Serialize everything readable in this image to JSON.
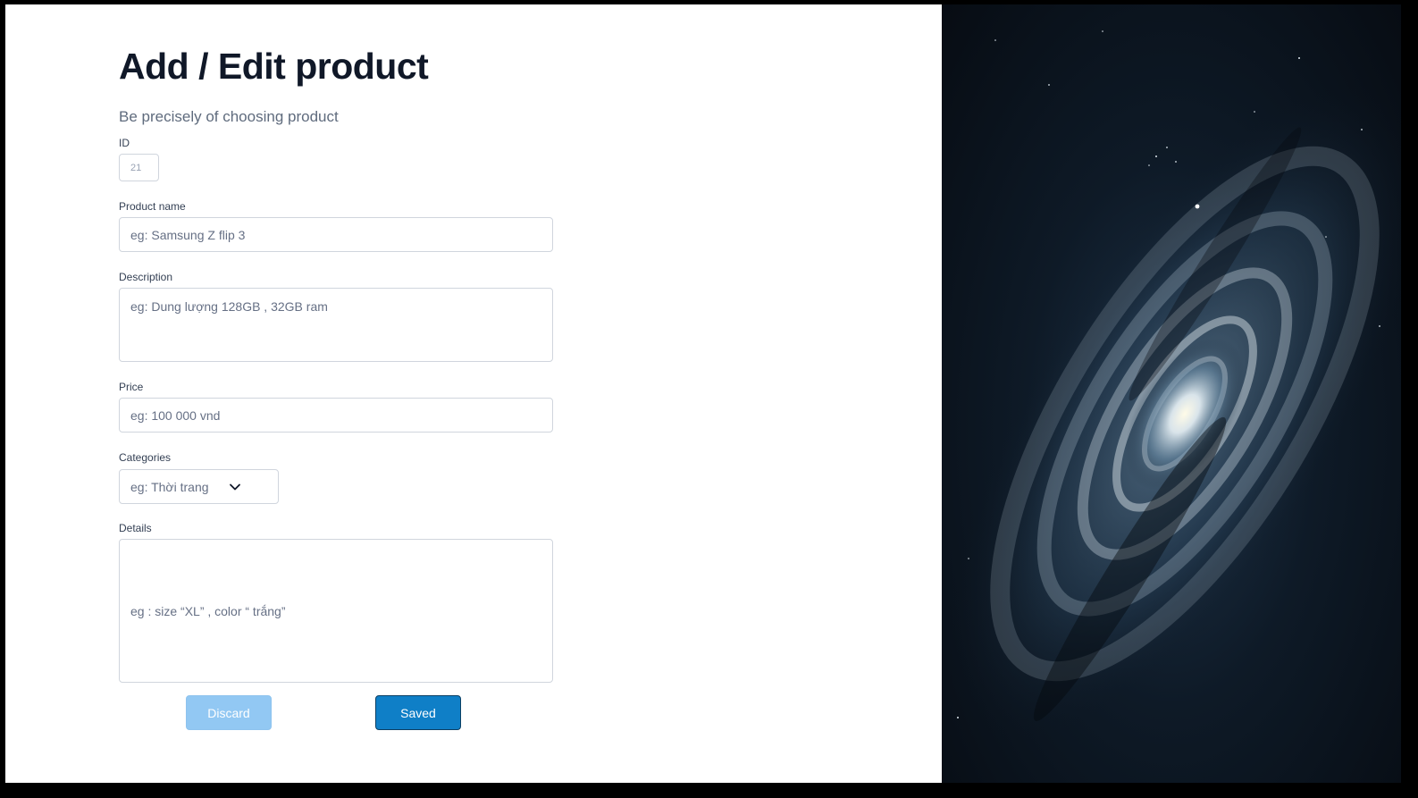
{
  "form": {
    "title": "Add / Edit product",
    "subtitle": "Be precisely of choosing product",
    "id": {
      "label": "ID",
      "placeholder": "21"
    },
    "product_name": {
      "label": "Product name",
      "placeholder": "eg: Samsung Z flip 3"
    },
    "description": {
      "label": "Description",
      "placeholder": "eg: Dung lượng 128GB , 32GB ram"
    },
    "price": {
      "label": "Price",
      "placeholder": "eg: 100 000 vnd"
    },
    "categories": {
      "label": "Categories",
      "selected": "eg: Thời trang",
      "icon": "chevron-down-icon"
    },
    "details": {
      "label": "Details",
      "placeholder": "eg : size “XL” , color “ trắng”"
    }
  },
  "actions": {
    "discard_label": "Discard",
    "save_label": "Saved"
  },
  "colors": {
    "title": "#101828",
    "subtitle": "#5f6b7d",
    "discard": "#92c8f3",
    "save": "#0f7fc7",
    "space_background": "#0b1520"
  }
}
